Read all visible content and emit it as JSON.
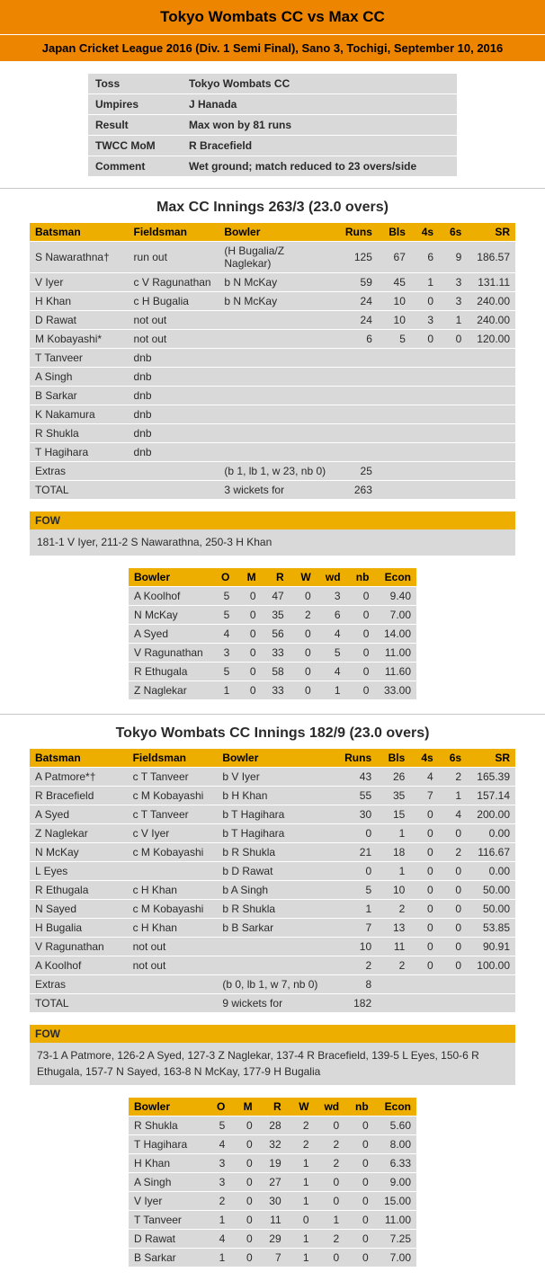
{
  "match": {
    "title": "Tokyo Wombats CC vs Max CC",
    "subtitle": "Japan Cricket League 2016 (Div. 1 Semi Final), Sano 3, Tochigi, September 10, 2016"
  },
  "info": {
    "toss_label": "Toss",
    "toss": "Tokyo Wombats CC",
    "umpires_label": "Umpires",
    "umpires": "J Hanada",
    "result_label": "Result",
    "result": "Max won by 81 runs",
    "mom_label": "TWCC MoM",
    "mom": "R Bracefield",
    "comment_label": "Comment",
    "comment": "Wet ground; match reduced to 23 overs/side"
  },
  "innings1": {
    "title": "Max CC Innings 263/3 (23.0 overs)",
    "headers": {
      "batsman": "Batsman",
      "fieldsman": "Fieldsman",
      "bowler": "Bowler",
      "runs": "Runs",
      "bls": "Bls",
      "fours": "4s",
      "sixes": "6s",
      "sr": "SR"
    },
    "rows": [
      {
        "batsman": "S Nawarathna†",
        "fieldsman": "run out",
        "bowler": "(H Bugalia/Z Naglekar)",
        "runs": "125",
        "bls": "67",
        "fours": "6",
        "sixes": "9",
        "sr": "186.57"
      },
      {
        "batsman": "V Iyer",
        "fieldsman": "c V Ragunathan",
        "bowler": "b N McKay",
        "runs": "59",
        "bls": "45",
        "fours": "1",
        "sixes": "3",
        "sr": "131.11"
      },
      {
        "batsman": "H Khan",
        "fieldsman": "c H Bugalia",
        "bowler": "b N McKay",
        "runs": "24",
        "bls": "10",
        "fours": "0",
        "sixes": "3",
        "sr": "240.00"
      },
      {
        "batsman": "D Rawat",
        "fieldsman": "not out",
        "bowler": "",
        "runs": "24",
        "bls": "10",
        "fours": "3",
        "sixes": "1",
        "sr": "240.00"
      },
      {
        "batsman": "M Kobayashi*",
        "fieldsman": "not out",
        "bowler": "",
        "runs": "6",
        "bls": "5",
        "fours": "0",
        "sixes": "0",
        "sr": "120.00"
      },
      {
        "batsman": "T Tanveer",
        "fieldsman": "dnb",
        "bowler": "",
        "runs": "",
        "bls": "",
        "fours": "",
        "sixes": "",
        "sr": ""
      },
      {
        "batsman": "A Singh",
        "fieldsman": "dnb",
        "bowler": "",
        "runs": "",
        "bls": "",
        "fours": "",
        "sixes": "",
        "sr": ""
      },
      {
        "batsman": "B Sarkar",
        "fieldsman": "dnb",
        "bowler": "",
        "runs": "",
        "bls": "",
        "fours": "",
        "sixes": "",
        "sr": ""
      },
      {
        "batsman": "K Nakamura",
        "fieldsman": "dnb",
        "bowler": "",
        "runs": "",
        "bls": "",
        "fours": "",
        "sixes": "",
        "sr": ""
      },
      {
        "batsman": "R Shukla",
        "fieldsman": "dnb",
        "bowler": "",
        "runs": "",
        "bls": "",
        "fours": "",
        "sixes": "",
        "sr": ""
      },
      {
        "batsman": "T Hagihara",
        "fieldsman": "dnb",
        "bowler": "",
        "runs": "",
        "bls": "",
        "fours": "",
        "sixes": "",
        "sr": ""
      }
    ],
    "extras_label": "Extras",
    "extras_detail": "(b 1, lb 1, w 23, nb 0)",
    "extras_runs": "25",
    "total_label": "TOTAL",
    "total_detail": "3 wickets for",
    "total_runs": "263",
    "fow_label": "FOW",
    "fow": "181-1 V Iyer, 211-2 S Nawarathna, 250-3 H Khan",
    "bowl_headers": {
      "bowler": "Bowler",
      "o": "O",
      "m": "M",
      "r": "R",
      "w": "W",
      "wd": "wd",
      "nb": "nb",
      "econ": "Econ"
    },
    "bowlers": [
      {
        "name": "A Koolhof",
        "o": "5",
        "m": "0",
        "r": "47",
        "w": "0",
        "wd": "3",
        "nb": "0",
        "econ": "9.40"
      },
      {
        "name": "N McKay",
        "o": "5",
        "m": "0",
        "r": "35",
        "w": "2",
        "wd": "6",
        "nb": "0",
        "econ": "7.00"
      },
      {
        "name": "A Syed",
        "o": "4",
        "m": "0",
        "r": "56",
        "w": "0",
        "wd": "4",
        "nb": "0",
        "econ": "14.00"
      },
      {
        "name": "V Ragunathan",
        "o": "3",
        "m": "0",
        "r": "33",
        "w": "0",
        "wd": "5",
        "nb": "0",
        "econ": "11.00"
      },
      {
        "name": "R Ethugala",
        "o": "5",
        "m": "0",
        "r": "58",
        "w": "0",
        "wd": "4",
        "nb": "0",
        "econ": "11.60"
      },
      {
        "name": "Z Naglekar",
        "o": "1",
        "m": "0",
        "r": "33",
        "w": "0",
        "wd": "1",
        "nb": "0",
        "econ": "33.00"
      }
    ]
  },
  "innings2": {
    "title": "Tokyo Wombats CC Innings 182/9 (23.0 overs)",
    "headers": {
      "batsman": "Batsman",
      "fieldsman": "Fieldsman",
      "bowler": "Bowler",
      "runs": "Runs",
      "bls": "Bls",
      "fours": "4s",
      "sixes": "6s",
      "sr": "SR"
    },
    "rows": [
      {
        "batsman": "A Patmore*†",
        "fieldsman": "c T Tanveer",
        "bowler": "b V Iyer",
        "runs": "43",
        "bls": "26",
        "fours": "4",
        "sixes": "2",
        "sr": "165.39"
      },
      {
        "batsman": "R Bracefield",
        "fieldsman": "c M Kobayashi",
        "bowler": "b H Khan",
        "runs": "55",
        "bls": "35",
        "fours": "7",
        "sixes": "1",
        "sr": "157.14"
      },
      {
        "batsman": "A Syed",
        "fieldsman": "c T Tanveer",
        "bowler": "b T Hagihara",
        "runs": "30",
        "bls": "15",
        "fours": "0",
        "sixes": "4",
        "sr": "200.00"
      },
      {
        "batsman": "Z Naglekar",
        "fieldsman": "c V Iyer",
        "bowler": "b T Hagihara",
        "runs": "0",
        "bls": "1",
        "fours": "0",
        "sixes": "0",
        "sr": "0.00"
      },
      {
        "batsman": "N McKay",
        "fieldsman": "c M Kobayashi",
        "bowler": "b R Shukla",
        "runs": "21",
        "bls": "18",
        "fours": "0",
        "sixes": "2",
        "sr": "116.67"
      },
      {
        "batsman": "L Eyes",
        "fieldsman": "",
        "bowler": "b D Rawat",
        "runs": "0",
        "bls": "1",
        "fours": "0",
        "sixes": "0",
        "sr": "0.00"
      },
      {
        "batsman": "R Ethugala",
        "fieldsman": "c H Khan",
        "bowler": "b A Singh",
        "runs": "5",
        "bls": "10",
        "fours": "0",
        "sixes": "0",
        "sr": "50.00"
      },
      {
        "batsman": "N Sayed",
        "fieldsman": "c M Kobayashi",
        "bowler": "b R Shukla",
        "runs": "1",
        "bls": "2",
        "fours": "0",
        "sixes": "0",
        "sr": "50.00"
      },
      {
        "batsman": "H Bugalia",
        "fieldsman": "c H Khan",
        "bowler": "b B Sarkar",
        "runs": "7",
        "bls": "13",
        "fours": "0",
        "sixes": "0",
        "sr": "53.85"
      },
      {
        "batsman": "V Ragunathan",
        "fieldsman": "not out",
        "bowler": "",
        "runs": "10",
        "bls": "11",
        "fours": "0",
        "sixes": "0",
        "sr": "90.91"
      },
      {
        "batsman": "A Koolhof",
        "fieldsman": "not out",
        "bowler": "",
        "runs": "2",
        "bls": "2",
        "fours": "0",
        "sixes": "0",
        "sr": "100.00"
      }
    ],
    "extras_label": "Extras",
    "extras_detail": "(b 0, lb 1, w 7, nb 0)",
    "extras_runs": "8",
    "total_label": "TOTAL",
    "total_detail": "9 wickets for",
    "total_runs": "182",
    "fow_label": "FOW",
    "fow": "73-1 A Patmore, 126-2 A Syed, 127-3 Z Naglekar, 137-4 R Bracefield, 139-5 L Eyes, 150-6 R Ethugala, 157-7 N Sayed, 163-8 N McKay, 177-9 H Bugalia",
    "bowl_headers": {
      "bowler": "Bowler",
      "o": "O",
      "m": "M",
      "r": "R",
      "w": "W",
      "wd": "wd",
      "nb": "nb",
      "econ": "Econ"
    },
    "bowlers": [
      {
        "name": "R Shukla",
        "o": "5",
        "m": "0",
        "r": "28",
        "w": "2",
        "wd": "0",
        "nb": "0",
        "econ": "5.60"
      },
      {
        "name": "T Hagihara",
        "o": "4",
        "m": "0",
        "r": "32",
        "w": "2",
        "wd": "2",
        "nb": "0",
        "econ": "8.00"
      },
      {
        "name": "H Khan",
        "o": "3",
        "m": "0",
        "r": "19",
        "w": "1",
        "wd": "2",
        "nb": "0",
        "econ": "6.33"
      },
      {
        "name": "A Singh",
        "o": "3",
        "m": "0",
        "r": "27",
        "w": "1",
        "wd": "0",
        "nb": "0",
        "econ": "9.00"
      },
      {
        "name": "V Iyer",
        "o": "2",
        "m": "0",
        "r": "30",
        "w": "1",
        "wd": "0",
        "nb": "0",
        "econ": "15.00"
      },
      {
        "name": "T Tanveer",
        "o": "1",
        "m": "0",
        "r": "11",
        "w": "0",
        "wd": "1",
        "nb": "0",
        "econ": "11.00"
      },
      {
        "name": "D Rawat",
        "o": "4",
        "m": "0",
        "r": "29",
        "w": "1",
        "wd": "2",
        "nb": "0",
        "econ": "7.25"
      },
      {
        "name": "B Sarkar",
        "o": "1",
        "m": "0",
        "r": "7",
        "w": "1",
        "wd": "0",
        "nb": "0",
        "econ": "7.00"
      }
    ]
  }
}
